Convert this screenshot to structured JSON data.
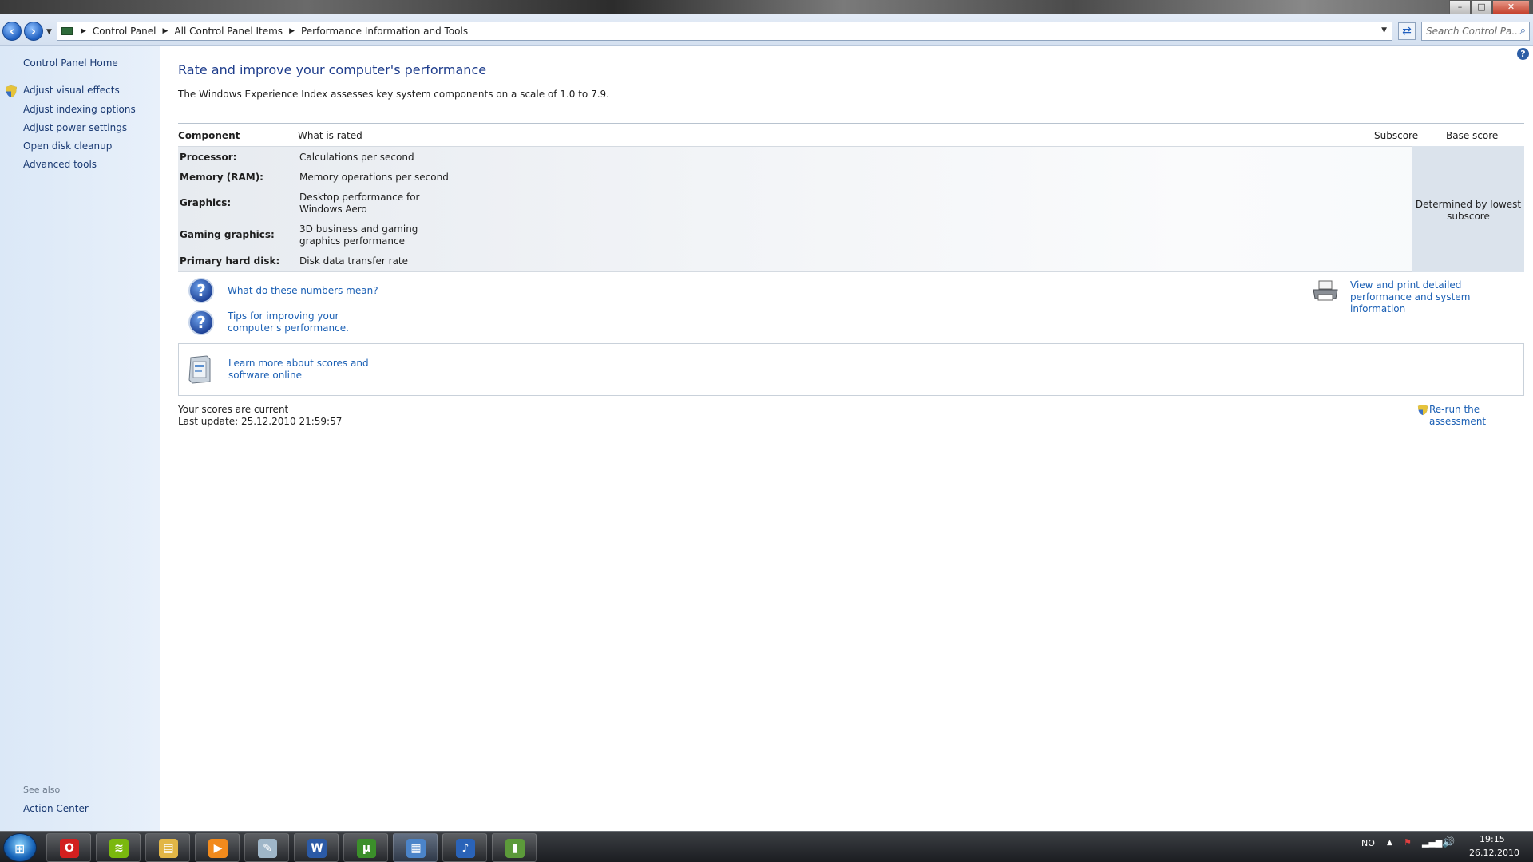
{
  "window": {
    "title": "",
    "controls": {
      "minimize": "–",
      "maximize": "□",
      "close": "✕"
    }
  },
  "addressbar": {
    "crumbs": [
      "Control Panel",
      "All Control Panel Items",
      "Performance Information and Tools"
    ],
    "search_placeholder": "Search Control Pa..."
  },
  "sidebar": {
    "home": "Control Panel Home",
    "tasks": [
      "Adjust visual effects",
      "Adjust indexing options",
      "Adjust power settings",
      "Open disk cleanup",
      "Advanced tools"
    ],
    "see_also_label": "See also",
    "see_also_items": [
      "Action Center"
    ]
  },
  "main": {
    "heading": "Rate and improve your computer's performance",
    "intro": "The Windows Experience Index assesses key system components on a scale of 1.0 to 7.9.",
    "columns": {
      "component": "Component",
      "what_rated": "What is rated",
      "subscore": "Subscore",
      "base_score": "Base score"
    },
    "rows": [
      {
        "component": "Processor:",
        "rated": "Calculations per second"
      },
      {
        "component": "Memory (RAM):",
        "rated": "Memory operations per second"
      },
      {
        "component": "Graphics:",
        "rated": "Desktop performance for Windows Aero"
      },
      {
        "component": "Gaming graphics:",
        "rated": "3D business and gaming graphics performance"
      },
      {
        "component": "Primary hard disk:",
        "rated": "Disk data transfer rate"
      }
    ],
    "base_note": "Determined by lowest subscore",
    "links": {
      "numbers_meaning": "What do these numbers mean?",
      "tips": "Tips for improving your computer's performance.",
      "print": "View and print detailed performance and system information",
      "learn": "Learn more about scores and software online",
      "rerun": "Re-run the assessment"
    },
    "status_line1": "Your scores are current",
    "status_line2": "Last update: 25.12.2010 21:59:57"
  },
  "taskbar": {
    "apps": [
      {
        "name": "opera",
        "glyph": "O",
        "color": "#d21f1f"
      },
      {
        "name": "spotify",
        "glyph": "≋",
        "color": "#7ab80e"
      },
      {
        "name": "explorer",
        "glyph": "▤",
        "color": "#e2b646"
      },
      {
        "name": "media-player",
        "glyph": "▶",
        "color": "#f28a1c"
      },
      {
        "name": "notes",
        "glyph": "✎",
        "color": "#9fb6c8"
      },
      {
        "name": "word",
        "glyph": "W",
        "color": "#2b5aa6"
      },
      {
        "name": "utorrent",
        "glyph": "µ",
        "color": "#3b8f2a"
      },
      {
        "name": "control-panel",
        "glyph": "▦",
        "color": "#4b84c9"
      },
      {
        "name": "itunes",
        "glyph": "♪",
        "color": "#2a63b8"
      },
      {
        "name": "device-sync",
        "glyph": "▮",
        "color": "#5c9a3a"
      }
    ],
    "language": "NO",
    "time": "19:15",
    "date": "26.12.2010"
  }
}
